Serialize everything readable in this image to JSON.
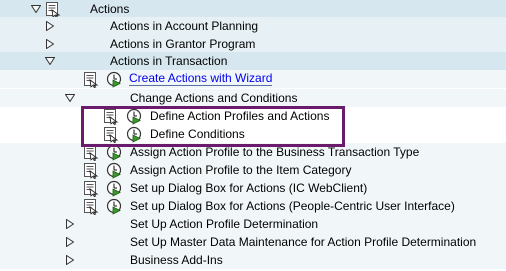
{
  "tree": {
    "root": {
      "label": "Actions"
    },
    "items": [
      {
        "label": "Actions in Account Planning"
      },
      {
        "label": "Actions in Grantor Program"
      },
      {
        "label": "Actions in Transaction"
      },
      {
        "label": "Create Actions with Wizard"
      },
      {
        "label": "Change Actions and Conditions"
      },
      {
        "label": "Define Action Profiles and Actions"
      },
      {
        "label": "Define Conditions"
      },
      {
        "label": "Assign Action Profile to the Business Transaction Type"
      },
      {
        "label": "Assign Action Profile to the Item Category"
      },
      {
        "label": "Set up Dialog Box for Actions (IC WebClient)"
      },
      {
        "label": "Set up Dialog Box for Actions (People-Centric User Interface)"
      },
      {
        "label": "Set Up Action Profile Determination"
      },
      {
        "label": "Set Up Master Data Maintenance for Action Profile Determination"
      },
      {
        "label": "Business Add-Ins"
      }
    ]
  },
  "colors": {
    "highlight_border": "#6a1b6b",
    "row_shade": "#d7e7ef",
    "link": "#0000ee",
    "activity_icon": "#3a9a2a"
  },
  "icons": {
    "expand": "triangle-right-icon",
    "collapse": "triangle-down-icon",
    "docs": "documentation-icon",
    "activity": "clock-execute-icon"
  }
}
